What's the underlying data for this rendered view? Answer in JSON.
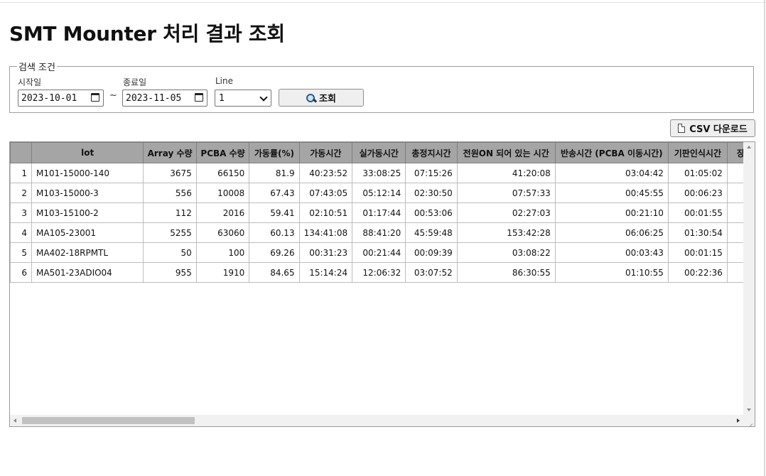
{
  "page": {
    "title": "SMT Mounter 처리 결과 조회"
  },
  "search": {
    "legend": "검색 조건",
    "start_label": "시작일",
    "start_value": "2023-10-01",
    "range_sep": "~",
    "end_label": "종료일",
    "end_value": "2023-11-05",
    "line_label": "Line",
    "line_value": "1",
    "search_button": "조회",
    "search_icon": "magnifier-icon"
  },
  "toolbar": {
    "csv_button": "CSV 다운로드",
    "csv_icon": "document-icon"
  },
  "table": {
    "columns": [
      "",
      "lot",
      "Array 수량",
      "PCBA 수량",
      "가동률(%)",
      "가동시간",
      "실가동시간",
      "총정지시간",
      "전원ON 되어 있는 시간",
      "반송시간 (PCBA 이동시간)",
      "기판인식시간",
      "장"
    ],
    "rows": [
      {
        "n": "1",
        "lot": "M101-15000-140",
        "array": "3675",
        "pcba": "66150",
        "rate": "81.9",
        "run": "40:23:52",
        "actual": "33:08:25",
        "stop": "07:15:26",
        "power": "41:20:08",
        "transfer": "03:04:42",
        "recog": "01:05:02"
      },
      {
        "n": "2",
        "lot": "M103-15000-3",
        "array": "556",
        "pcba": "10008",
        "rate": "67.43",
        "run": "07:43:05",
        "actual": "05:12:14",
        "stop": "02:30:50",
        "power": "07:57:33",
        "transfer": "00:45:55",
        "recog": "00:06:23"
      },
      {
        "n": "3",
        "lot": "M103-15100-2",
        "array": "112",
        "pcba": "2016",
        "rate": "59.41",
        "run": "02:10:51",
        "actual": "01:17:44",
        "stop": "00:53:06",
        "power": "02:27:03",
        "transfer": "00:21:10",
        "recog": "00:01:55"
      },
      {
        "n": "4",
        "lot": "MA105-23001",
        "array": "5255",
        "pcba": "63060",
        "rate": "60.13",
        "run": "134:41:08",
        "actual": "88:41:20",
        "stop": "45:59:48",
        "power": "153:42:28",
        "transfer": "06:06:25",
        "recog": "01:30:54"
      },
      {
        "n": "5",
        "lot": "MA402-18RPMTL",
        "array": "50",
        "pcba": "100",
        "rate": "69.26",
        "run": "00:31:23",
        "actual": "00:21:44",
        "stop": "00:09:39",
        "power": "03:08:22",
        "transfer": "00:03:43",
        "recog": "00:01:15"
      },
      {
        "n": "6",
        "lot": "MA501-23ADIO04",
        "array": "955",
        "pcba": "1910",
        "rate": "84.65",
        "run": "15:14:24",
        "actual": "12:06:32",
        "stop": "03:07:52",
        "power": "86:30:55",
        "transfer": "01:10:55",
        "recog": "00:22:36"
      }
    ]
  }
}
